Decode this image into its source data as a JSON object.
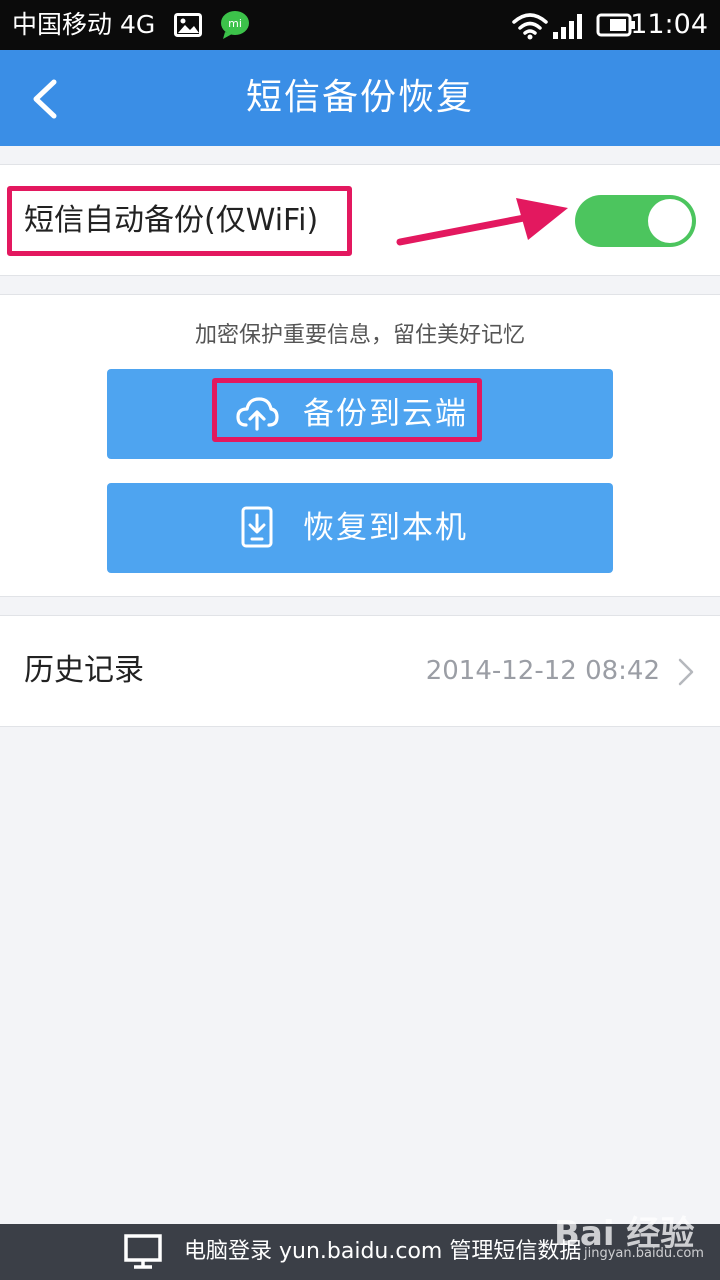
{
  "status_bar": {
    "carrier": "中国移动 4G",
    "time": "11:04",
    "icons": [
      "gallery-icon",
      "mi-chat-icon",
      "wifi-icon",
      "signal-icon",
      "battery-icon"
    ]
  },
  "nav": {
    "title": "短信备份恢复",
    "back_icon": "chevron-left-icon"
  },
  "auto_backup": {
    "label": "短信自动备份(仅WiFi)",
    "enabled": true
  },
  "backup_panel": {
    "tagline": "加密保护重要信息，留住美好记忆",
    "backup_label": "备份到云端",
    "backup_icon": "cloud-upload-icon",
    "restore_label": "恢复到本机",
    "restore_icon": "phone-download-icon"
  },
  "history": {
    "label": "历史记录",
    "last_time": "2014-12-12 08:42"
  },
  "bottom_bar": {
    "text": "电脑登录 yun.baidu.com 管理短信数据",
    "icon": "monitor-icon"
  },
  "watermark": {
    "brand": "Bai 经验",
    "url": "jingyan.baidu.com"
  },
  "colors": {
    "nav": "#3a8ee6",
    "button": "#4ea4f0",
    "toggle_on": "#4cc55e",
    "highlight": "#e3185f",
    "bottom_bar": "#3b3f47"
  }
}
